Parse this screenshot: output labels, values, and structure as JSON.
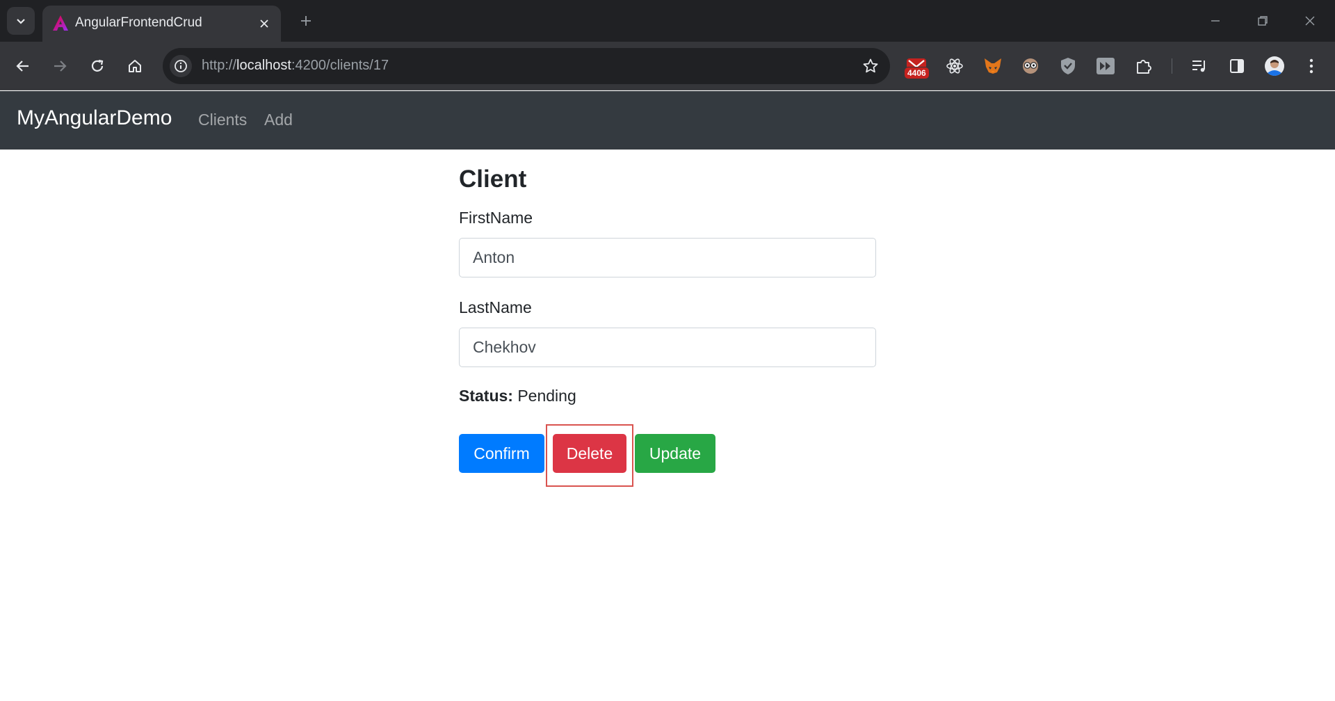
{
  "browser": {
    "tab_title": "AngularFrontendCrud",
    "url_scheme": "http://",
    "url_host": "localhost",
    "url_rest": ":4200/clients/17",
    "ext_badge": "4406",
    "colors": {
      "tabbar": "#202124",
      "toolbar": "#35363a"
    }
  },
  "navbar": {
    "brand": "MyAngularDemo",
    "links": [
      "Clients",
      "Add"
    ],
    "color": "#343a40"
  },
  "form": {
    "heading": "Client",
    "first_name_label": "FirstName",
    "first_name_value": "Anton",
    "last_name_label": "LastName",
    "last_name_value": "Chekhov",
    "status_label": "Status:",
    "status_value": "Pending",
    "buttons": {
      "confirm": "Confirm",
      "delete": "Delete",
      "update": "Update"
    },
    "colors": {
      "confirm": "#007bff",
      "delete": "#dc3545",
      "update": "#28a745",
      "highlight": "#d9534f"
    }
  }
}
